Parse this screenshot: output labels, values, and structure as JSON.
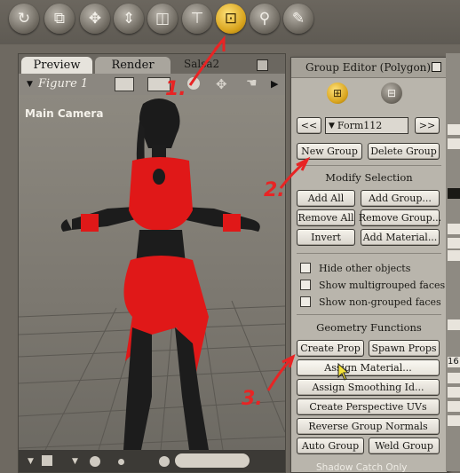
{
  "toolbar": {
    "tools": [
      {
        "icon": "rotate-icon",
        "glyph": "↻"
      },
      {
        "icon": "twist-icon",
        "glyph": "⟟"
      },
      {
        "icon": "translate-icon",
        "glyph": "✥"
      },
      {
        "icon": "translate-in-out-icon",
        "glyph": "⇕"
      },
      {
        "icon": "scale-icon",
        "glyph": "◫"
      },
      {
        "icon": "taper-icon",
        "glyph": "⊤"
      },
      {
        "icon": "grouping-tool-icon",
        "glyph": "⊡"
      },
      {
        "icon": "view-magnifier-icon",
        "glyph": "⚲"
      },
      {
        "icon": "eyedropper-icon",
        "glyph": "⁄"
      }
    ],
    "active_tool": "grouping-tool-icon"
  },
  "preview": {
    "tab_preview": "Preview",
    "tab_render": "Render",
    "window_title": "Salsa2",
    "figure_label": "Figure 1",
    "camera_label": "Main Camera"
  },
  "group_editor": {
    "title": "Group Editor (Polygon)",
    "prev_label": "<<",
    "next_label": ">>",
    "group_name": "Form112",
    "new_group": "New Group",
    "delete_group": "Delete Group",
    "modify_selection_title": "Modify Selection",
    "add_all": "Add All",
    "add_group": "Add Group...",
    "remove_all": "Remove All",
    "remove_group": "Remove Group...",
    "invert": "Invert",
    "add_material": "Add Material...",
    "hide_other_objects": "Hide other objects",
    "show_multigrouped": "Show multigrouped faces",
    "show_non_grouped": "Show non-grouped faces",
    "geometry_functions_title": "Geometry Functions",
    "create_prop": "Create Prop",
    "spawn_props": "Spawn Props",
    "assign_material": "Assign Material...",
    "assign_smoothing": "Assign Smoothing Id...",
    "create_perspective_uvs": "Create Perspective UVs",
    "reverse_group_normals": "Reverse Group Normals",
    "auto_group": "Auto Group",
    "weld_group": "Weld Group"
  },
  "right_panel": {
    "value_16": "16",
    "bottom_label": "Shadow Catch Only"
  },
  "annotations": {
    "step1": "1.",
    "step2": "2.",
    "step3": "3.",
    "color": "#e82424"
  },
  "colors": {
    "accent_active_tool": "#d7a21b",
    "figure_clothing": "#e01818",
    "figure_skin": "#1c1c1c"
  }
}
